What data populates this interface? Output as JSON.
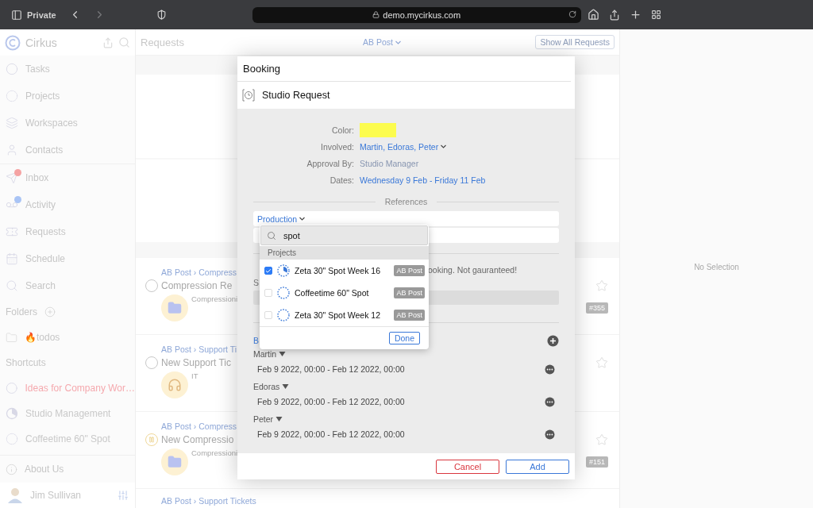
{
  "browser": {
    "mode_label": "Private",
    "url": "demo.mycirkus.com"
  },
  "sidebar": {
    "app_name": "Cirkus",
    "nav": [
      {
        "label": "Tasks",
        "kind": "circle"
      },
      {
        "label": "Projects",
        "kind": "dotted"
      },
      {
        "label": "Workspaces",
        "kind": "workspace"
      },
      {
        "label": "Contacts",
        "kind": "contact"
      },
      {
        "label": "Inbox",
        "kind": "inbox",
        "badge": {
          "color": "#f5a3a3"
        }
      },
      {
        "label": "Activity",
        "kind": "activity",
        "badge": {
          "color": "#a9c4f5"
        }
      },
      {
        "label": "Requests",
        "kind": "requests"
      },
      {
        "label": "Schedule",
        "kind": "schedule"
      },
      {
        "label": "Search",
        "kind": "search"
      }
    ],
    "folders_title": "Folders",
    "folders": [
      {
        "label": "🔥todos"
      }
    ],
    "shortcuts_title": "Shortcuts",
    "shortcuts": [
      {
        "label": "Ideas for Company Wor…",
        "kind": "circle",
        "color": "#f5a9ae"
      },
      {
        "label": "Studio Management",
        "kind": "pie",
        "color": "#c9c9c9"
      },
      {
        "label": "Coffeetime 60\" Spot",
        "kind": "dotted",
        "color": "#c9c9c9"
      }
    ],
    "about": "About Us",
    "user": "Jim Sullivan"
  },
  "requests_pane": {
    "title": "Requests",
    "filter": "AB Post",
    "show_all": "Show All Requests",
    "items": [
      {
        "breadcrumb": "AB Post › Compress",
        "title": "Compression Re",
        "subtitle": "Compressioni",
        "avatar": {
          "kind": "folder"
        },
        "status": {
          "kind": "open"
        },
        "badge": "#355"
      },
      {
        "breadcrumb": "AB Post › Support Ti",
        "title": "New Support Tic",
        "subtitle": "IT",
        "avatar": {
          "kind": "headset"
        },
        "status": {
          "kind": "open"
        }
      },
      {
        "breadcrumb": "AB Post › Compress",
        "title": "New Compressio",
        "subtitle": "Compressioni",
        "avatar": {
          "kind": "folder"
        },
        "status": {
          "kind": "paused"
        },
        "badge": "#151"
      },
      {
        "breadcrumb": "AB Post › Support Tickets"
      }
    ]
  },
  "detail_pane": {
    "empty_text": "No Selection"
  },
  "modal": {
    "title": "Booking",
    "type": "Studio Request",
    "fields": [
      {
        "label": "Color:",
        "kind": "swatch",
        "color": "#fcfc4e"
      },
      {
        "label": "Involved:",
        "kind": "dropdown",
        "value": "Martin, Edoras, Peter"
      },
      {
        "label": "Approval By:",
        "kind": "text",
        "value": "Studio Manager"
      },
      {
        "label": "Dates:",
        "kind": "link",
        "value": "Wednesday 9 Feb - Friday 11 Feb"
      }
    ],
    "references_title": "References",
    "reference_kind": "Production",
    "note": "ooking. Not gauranteed!",
    "section_label": "S",
    "bookings_label": "B",
    "bookings": [
      {
        "person": "Martin",
        "range": "Feb 9 2022, 00:00 - Feb 12 2022, 00:00"
      },
      {
        "person": "Edoras",
        "range": "Feb 9 2022, 00:00 - Feb 12 2022, 00:00"
      },
      {
        "person": "Peter",
        "range": "Feb 9 2022, 00:00 - Feb 12 2022, 00:00"
      }
    ],
    "cancel": "Cancel",
    "add": "Add",
    "project_picker": {
      "search": "spot",
      "group": "Projects",
      "items": [
        {
          "name": "Zeta 30\" Spot Week 16",
          "tag": "AB Post",
          "checked": true,
          "kind": "started"
        },
        {
          "name": "Coffeetime 60\" Spot",
          "tag": "AB Post",
          "checked": false,
          "kind": "none"
        },
        {
          "name": "Zeta 30\" Spot Week 12",
          "tag": "AB Post",
          "checked": false,
          "kind": "none"
        }
      ],
      "done": "Done"
    }
  }
}
